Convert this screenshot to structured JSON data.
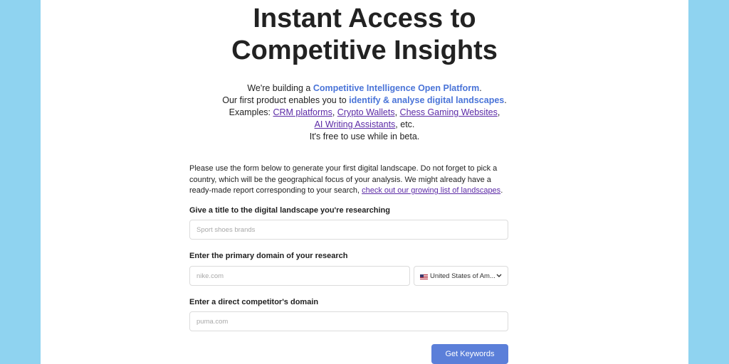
{
  "hero": {
    "title_line1": "Instant Access to",
    "title_line2": "Competitive Insights"
  },
  "intro": {
    "line1_prefix": "We're building a ",
    "line1_highlight": "Competitive Intelligence Open Platform",
    "line1_suffix": ".",
    "line2_prefix": "Our first product enables you to ",
    "line2_highlight": "identify & analyse digital landscapes",
    "line2_suffix": ".",
    "line3_prefix": "Examples: ",
    "examples": [
      "CRM platforms",
      "Crypto Wallets",
      "Chess Gaming Websites",
      "AI Writing Assistants"
    ],
    "sep": ", ",
    "etc": ", etc.",
    "line5": "It's free to use while in beta."
  },
  "form": {
    "description": "Please use the form below to generate your first digital landscape. Do not forget to pick a country, which will be the geographical focus of your analysis. We might already have a ready-made report corresponding to your search, ",
    "description_link": "check out our growing list of landscapes",
    "description_end": ".",
    "title_label": "Give a title to the digital landscape you're researching",
    "title_placeholder": "Sport shoes brands",
    "domain_label": "Enter the primary domain of your research",
    "domain_placeholder": "nike.com",
    "country_selected": "United States of Am...",
    "competitor_label": "Enter a direct competitor's domain",
    "competitor_placeholder": "puma.com",
    "submit_label": "Get Keywords"
  },
  "colors": {
    "background": "#8fd3f0",
    "highlight": "#4a74d8",
    "link": "#5b2aa6",
    "button": "#5b7fd9"
  },
  "icons": {
    "flag": "us-flag-icon",
    "dropdown": "chevron-down-icon"
  }
}
